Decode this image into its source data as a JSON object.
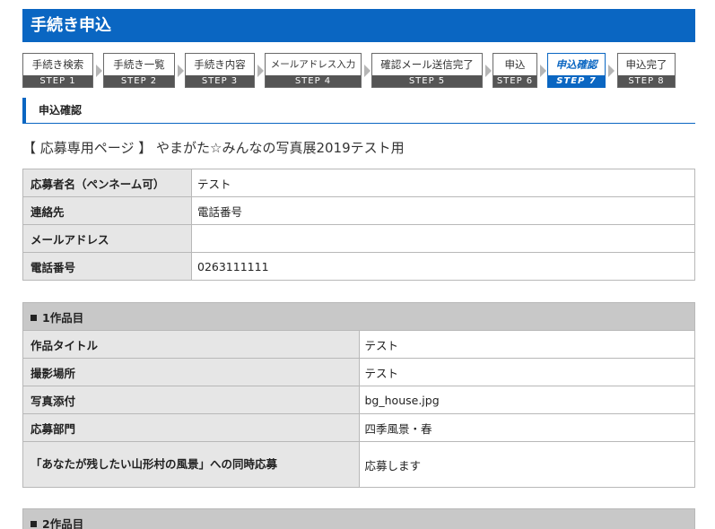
{
  "header": {
    "title": "手続き申込"
  },
  "steps": [
    {
      "label": "手続き検索",
      "num": "STEP 1",
      "active": false
    },
    {
      "label": "手続き一覧",
      "num": "STEP 2",
      "active": false
    },
    {
      "label": "手続き内容",
      "num": "STEP 3",
      "active": false
    },
    {
      "label": "メールアドレス入力",
      "num": "STEP 4",
      "active": false
    },
    {
      "label": "確認メール送信完了",
      "num": "STEP 5",
      "active": false
    },
    {
      "label": "申込",
      "num": "STEP 6",
      "active": false
    },
    {
      "label": "申込確認",
      "num": "STEP 7",
      "active": true
    },
    {
      "label": "申込完了",
      "num": "STEP 8",
      "active": false
    }
  ],
  "section": {
    "title": "申込確認"
  },
  "event": {
    "title": "【 応募専用ページ 】 やまがた☆みんなの写真展2019テスト用"
  },
  "applicant": [
    {
      "label": "応募者名（ペンネーム可）",
      "value": "テスト"
    },
    {
      "label": "連絡先",
      "value": "電話番号"
    },
    {
      "label": "メールアドレス",
      "value": ""
    },
    {
      "label": "電話番号",
      "value": "0263111111"
    }
  ],
  "work1": {
    "heading": "1作品目",
    "rows": [
      {
        "label": "作品タイトル",
        "value": "テスト"
      },
      {
        "label": "撮影場所",
        "value": "テスト"
      },
      {
        "label": "写真添付",
        "value": "bg_house.jpg"
      },
      {
        "label": "応募部門",
        "value": "四季風景・春"
      },
      {
        "label": "「あなたが残したい山形村の風景」への同時応募",
        "value": "応募します"
      }
    ]
  },
  "work2": {
    "heading": "2作品目"
  },
  "colors": {
    "accent": "#0a66c2",
    "label_bg": "#e6e6e6",
    "group_bg": "#c8c8c8"
  }
}
